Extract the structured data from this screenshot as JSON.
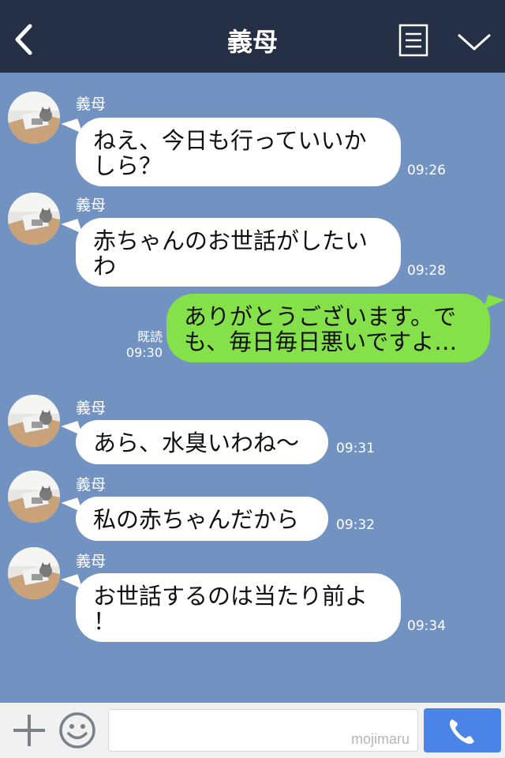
{
  "header": {
    "title": "義母",
    "back_icon": "chevron-left-icon",
    "menu_icon": "list-icon",
    "collapse_icon": "chevron-down-icon",
    "background": "#253046"
  },
  "chat": {
    "background": "#7293c1",
    "incoming_bubble_color": "#ffffff",
    "outgoing_bubble_color": "#85e149",
    "messages": [
      {
        "direction": "in",
        "sender": "義母",
        "lines": [
          "ねえ、今日も行っていいか",
          "しら？"
        ],
        "time": "09:26"
      },
      {
        "direction": "in",
        "sender": "義母",
        "lines": [
          "赤ちゃんのお世話がしたい",
          "わ"
        ],
        "time": "09:28"
      },
      {
        "direction": "out",
        "lines": [
          "ありがとうございます。で",
          "も、毎日毎日悪いですよ…"
        ],
        "read": "既読",
        "time": "09:30"
      },
      {
        "direction": "in",
        "sender": "義母",
        "lines": [
          "あら、水臭いわね〜"
        ],
        "time": "09:31"
      },
      {
        "direction": "in",
        "sender": "義母",
        "lines": [
          "私の赤ちゃんだから"
        ],
        "time": "09:32"
      },
      {
        "direction": "in",
        "sender": "義母",
        "lines": [
          "お世話するのは当たり前よ",
          "！"
        ],
        "time": "09:34"
      }
    ]
  },
  "input_bar": {
    "plus_icon": "plus-icon",
    "emoji_icon": "smiley-icon",
    "input_value": "",
    "watermark": "mojimaru",
    "call_icon": "phone-icon",
    "call_button_color": "#4a84e6"
  }
}
